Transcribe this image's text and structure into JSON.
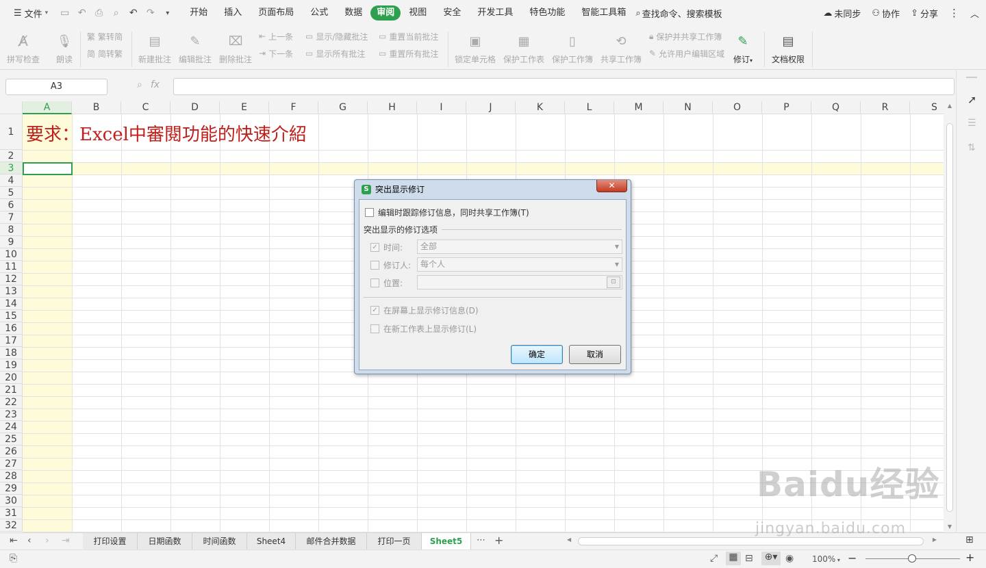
{
  "topbar": {
    "file_label": "文件",
    "tabs": [
      "开始",
      "插入",
      "页面布局",
      "公式",
      "数据",
      "审阅",
      "视图",
      "安全",
      "开发工具",
      "特色功能",
      "智能工具箱"
    ],
    "active_tab": "审阅",
    "search_label": "查找命令、搜索模板",
    "sync_label": "未同步",
    "collab_label": "协作",
    "share_label": "分享"
  },
  "ribbon": {
    "spell_check": "拼写检查",
    "read_aloud": "朗读",
    "trad_simp": "繁转简",
    "simp_trad": "简转繁",
    "new_comment": "新建批注",
    "edit_comment": "编辑批注",
    "delete_comment": "删除批注",
    "prev": "上一条",
    "next": "下一条",
    "show_hide_comment": "显示/隐藏批注",
    "show_all_comments": "显示所有批注",
    "reset_current": "重置当前批注",
    "reset_all": "重置所有批注",
    "lock_cell": "锁定单元格",
    "protect_sheet": "保护工作表",
    "protect_workbook": "保护工作簿",
    "share_workbook": "共享工作簿",
    "protect_share": "保护并共享工作簿",
    "allow_edit": "允许用户编辑区域",
    "track": "修订",
    "doc_rights": "文档权限"
  },
  "formula": {
    "namebox": "A3",
    "fx": "fx",
    "value": ""
  },
  "columns": [
    "A",
    "B",
    "C",
    "D",
    "E",
    "F",
    "G",
    "H",
    "I",
    "J",
    "K",
    "L",
    "M",
    "N",
    "O",
    "P",
    "Q",
    "R",
    "S"
  ],
  "rows": [
    "1",
    "2",
    "3",
    "4",
    "5",
    "6",
    "7",
    "8",
    "9",
    "10",
    "11",
    "12",
    "13",
    "14",
    "15",
    "16",
    "17",
    "18",
    "19",
    "20",
    "21",
    "22",
    "23",
    "24",
    "25",
    "26",
    "27",
    "28",
    "29",
    "30",
    "31",
    "32"
  ],
  "cell_A1": "要求：Excel中審閱功能的快速介紹",
  "dialog": {
    "title": "突出显示修订",
    "track_label": "编辑时跟踪修订信息，同时共享工作簿(T)",
    "group_label": "突出显示的修订选项",
    "time_label": "时间:",
    "time_value": "全部",
    "reviser_label": "修订人:",
    "reviser_value": "每个人",
    "location_label": "位置:",
    "show_screen_label": "在屏幕上显示修订信息(D)",
    "show_new_sheet_label": "在新工作表上显示修订(L)",
    "ok_label": "确定",
    "cancel_label": "取消"
  },
  "sheet_tabs": [
    "打印设置",
    "日期函数",
    "时间函数",
    "Sheet4",
    "邮件合并数据",
    "打印一页",
    "Sheet5"
  ],
  "active_sheet": "Sheet5",
  "status": {
    "zoom": "100%"
  },
  "watermark": {
    "text": "Baidu经验",
    "url": "jingyan.baidu.com"
  },
  "colors": {
    "accent": "#2e9e4f",
    "title_red": "#c0201b",
    "highlight": "#fdfbd9"
  }
}
